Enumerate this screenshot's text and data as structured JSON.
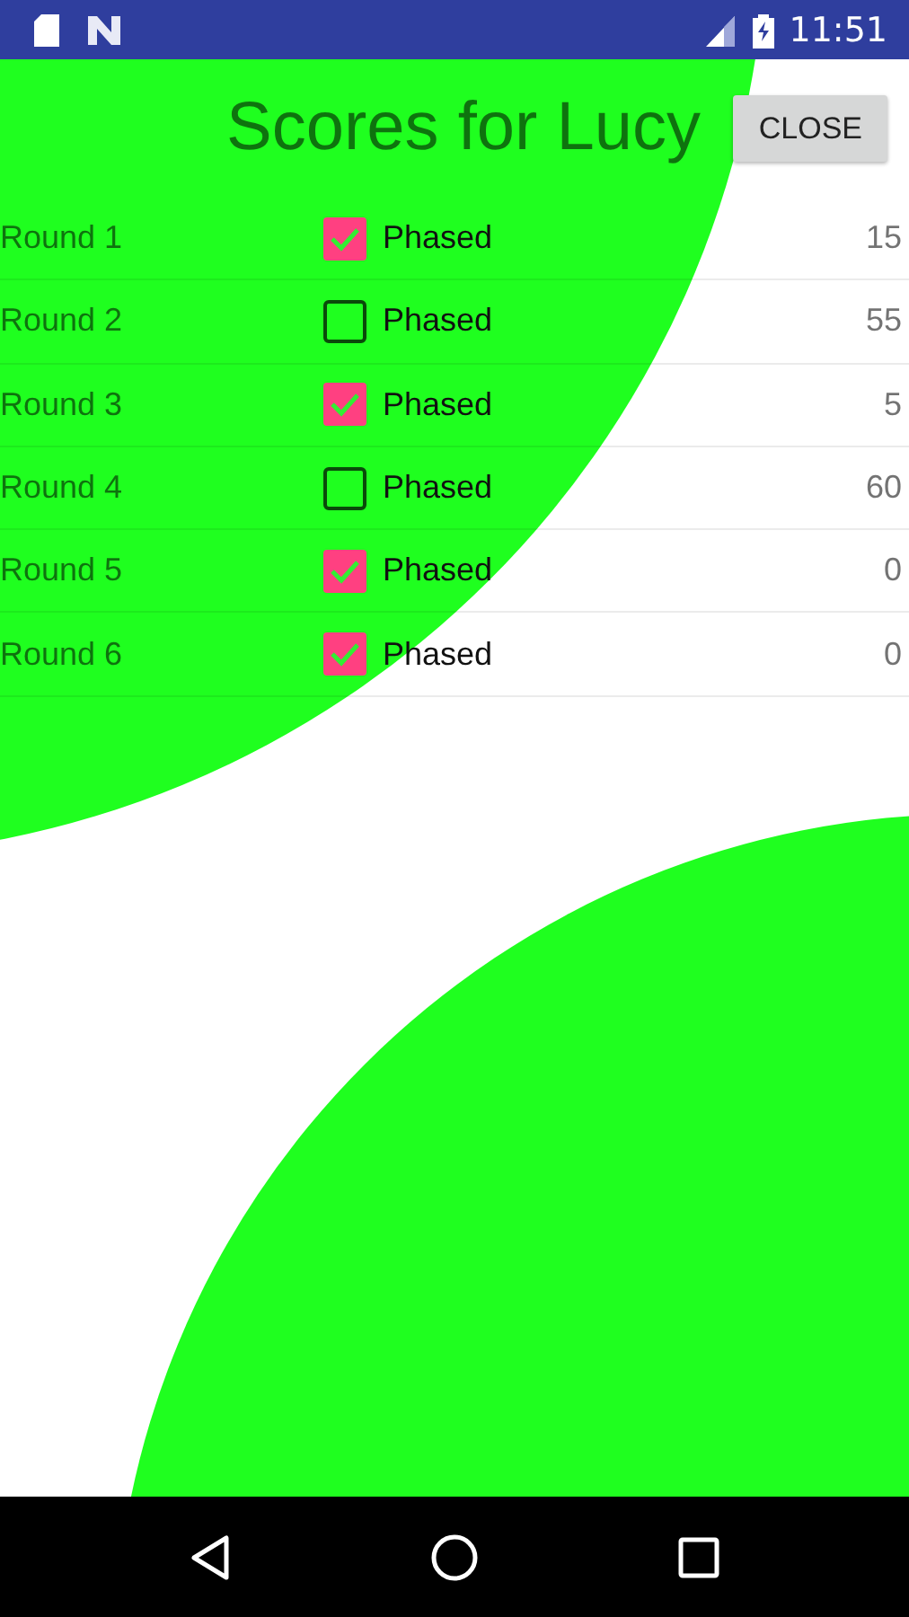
{
  "status_bar": {
    "time": "11:51"
  },
  "title": "Scores for Lucy",
  "close_button": "CLOSE",
  "rows": [
    {
      "round": "Round 1",
      "label": "Phased",
      "checked": true,
      "score": "15"
    },
    {
      "round": "Round 2",
      "label": "Phased",
      "checked": false,
      "score": "55"
    },
    {
      "round": "Round 3",
      "label": "Phased",
      "checked": true,
      "score": "5"
    },
    {
      "round": "Round 4",
      "label": "Phased",
      "checked": false,
      "score": "60"
    },
    {
      "round": "Round 5",
      "label": "Phased",
      "checked": true,
      "score": "0"
    },
    {
      "round": "Round 6",
      "label": "Phased",
      "checked": true,
      "score": "0"
    }
  ]
}
